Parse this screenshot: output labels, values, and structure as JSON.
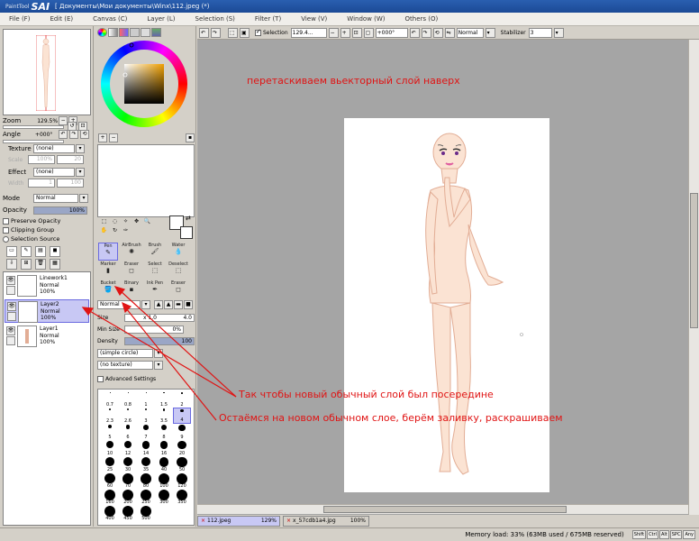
{
  "app": {
    "name": "SAI",
    "subtitle": "PaintTool",
    "document_title": "[ Документы\\Мои документы\\Winx\\112.jpeg (*)"
  },
  "menu": [
    {
      "label": "File (F)"
    },
    {
      "label": "Edit (E)"
    },
    {
      "label": "Canvas (C)"
    },
    {
      "label": "Layer (L)"
    },
    {
      "label": "Selection (S)"
    },
    {
      "label": "Filter (T)"
    },
    {
      "label": "View (V)"
    },
    {
      "label": "Window (W)"
    },
    {
      "label": "Others (O)"
    }
  ],
  "navigator": {
    "zoom_label": "Zoom",
    "zoom_value": "129.5%",
    "angle_label": "Angle",
    "angle_value": "+000°"
  },
  "texture": {
    "label": "Texture",
    "value": "(none)",
    "scale_label": "Scale",
    "scale_value": "100%",
    "scale_right": "20"
  },
  "effect": {
    "label": "Effect",
    "value": "(none)",
    "width_label": "Width",
    "width_value": "1",
    "width_right": "100"
  },
  "mode": {
    "label": "Mode",
    "value": "Normal"
  },
  "opacity": {
    "label": "Opacity",
    "value": "100%",
    "level": 1.0
  },
  "options": [
    {
      "label": "Preserve Opacity",
      "kind": "checkbox",
      "checked": false
    },
    {
      "label": "Clipping Group",
      "kind": "checkbox",
      "checked": false
    },
    {
      "label": "Selection Source",
      "kind": "radio",
      "checked": false
    }
  ],
  "layers": [
    {
      "name": "Linework1",
      "mode": "Normal",
      "opacity": "100%",
      "selected": false,
      "vector": true
    },
    {
      "name": "Layer2",
      "mode": "Normal",
      "opacity": "100%",
      "selected": true,
      "vector": false
    },
    {
      "name": "Layer1",
      "mode": "Normal",
      "opacity": "100%",
      "selected": false,
      "vector": false
    }
  ],
  "tools": [
    {
      "label": "Pen",
      "selected": true
    },
    {
      "label": "AirBrush",
      "selected": false
    },
    {
      "label": "Brush",
      "selected": false
    },
    {
      "label": "Water",
      "selected": false
    },
    {
      "label": "Marker",
      "selected": false
    },
    {
      "label": "Eraser",
      "selected": false
    },
    {
      "label": "Select",
      "selected": false
    },
    {
      "label": "Deselect",
      "selected": false
    },
    {
      "label": "Bucket",
      "selected": false
    },
    {
      "label": "Binary",
      "selected": false
    },
    {
      "label": "Ink Pen",
      "selected": false
    },
    {
      "label": "Eraser",
      "selected": false
    }
  ],
  "brush_settings": {
    "blend_mode": "Normal",
    "size_label": "Size",
    "size_mult": "x 1.0",
    "size_value": "4.0",
    "min_size_label": "Min Size",
    "min_size_value": "0%",
    "density_label": "Density",
    "density_value": "100",
    "shape": "(simple circle)",
    "texture": "(no texture)",
    "advanced_label": "Advanced Settings"
  },
  "brush_sizes": [
    "0.7",
    "0.8",
    "1",
    "1.5",
    "2",
    "2.3",
    "2.6",
    "3",
    "3.5",
    "4",
    "5",
    "6",
    "7",
    "8",
    "9",
    "10",
    "12",
    "14",
    "16",
    "20",
    "25",
    "30",
    "35",
    "40",
    "50",
    "60",
    "70",
    "80",
    "100",
    "120",
    "160",
    "200",
    "250",
    "300",
    "350",
    "400",
    "450",
    "500"
  ],
  "selected_brush_size": "4",
  "toolbar": {
    "selection_label": "Selection",
    "zoom_value": "129.4...",
    "angle_value": "+000°",
    "blend_value": "Normal",
    "stabilizer_label": "Stabilizer",
    "stabilizer_value": "3"
  },
  "annotations": {
    "top": "перетаскиваем вьекторный слой наверх",
    "middle": "Так чтобы новый обычный слой был посередине",
    "bottom": "Остаёмся на новом обычном слое, берём заливку, раскрашиваем"
  },
  "doc_tabs": [
    {
      "name": "112.jpeg",
      "zoom": "129%",
      "active": true
    },
    {
      "name": "x_57cdb1a4.jpg",
      "zoom": "100%",
      "active": false
    }
  ],
  "status": {
    "memory": "Memory load: 33% (63MB used / 675MB reserved)",
    "keys": [
      "Shift",
      "Ctrl",
      "Alt",
      "SPC",
      "Any"
    ]
  },
  "colors": {
    "annotation": "#e01414",
    "selection": "#c8c8f4",
    "skin": "#fbe3d3",
    "outline": "#e2ad95"
  }
}
